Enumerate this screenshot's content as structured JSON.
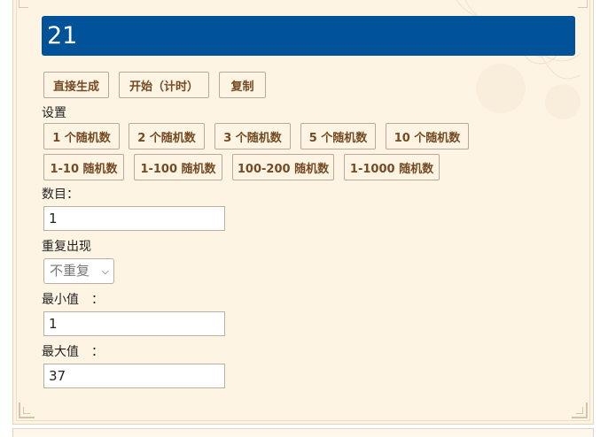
{
  "result": {
    "value": "21"
  },
  "actions": {
    "generate": "直接生成",
    "start": "开始（计时）",
    "copy": "复制"
  },
  "settings": {
    "title": "设置",
    "presets_count": [
      "1 个随机数",
      "2 个随机数",
      "3 个随机数",
      "5 个随机数",
      "10 个随机数"
    ],
    "presets_range": [
      "1-10 随机数",
      "1-100 随机数",
      "100-200 随机数",
      "1-1000 随机数"
    ]
  },
  "form": {
    "count_label": "数目：",
    "count_value": "1",
    "repeat_label": "重复出现",
    "repeat_selected": "不重复",
    "min_label": "最小值　：",
    "min_value": "1",
    "max_label": "最大值　：",
    "max_value": "37"
  },
  "colors": {
    "result_bg": "#005299",
    "panel_bg": "#fdf4e4",
    "button_text": "#744a22"
  }
}
